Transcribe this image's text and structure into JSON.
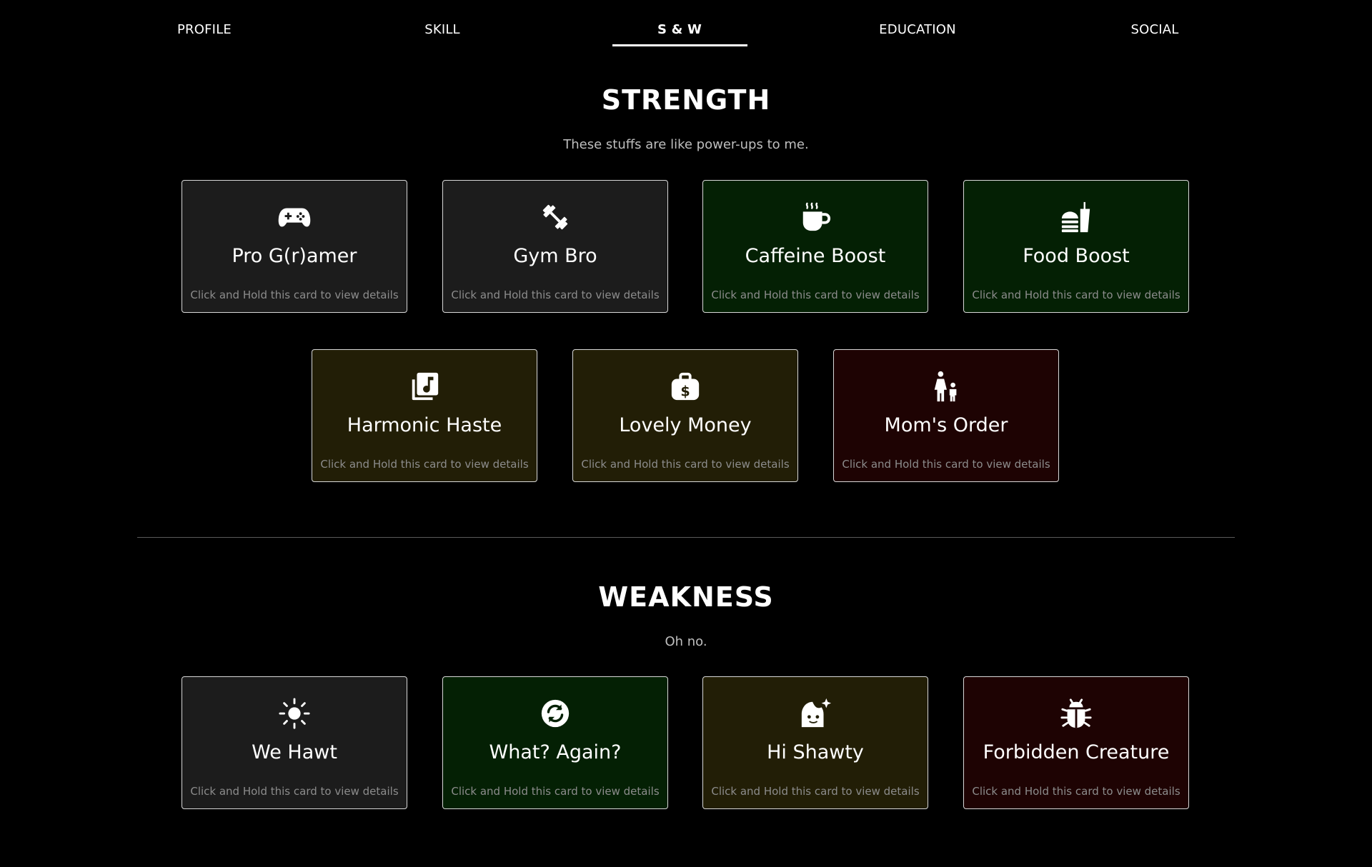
{
  "nav": {
    "items": [
      "PROFILE",
      "SKILL",
      "S & W",
      "EDUCATION",
      "SOCIAL"
    ],
    "active": "S & W"
  },
  "strength": {
    "title": "STRENGTH",
    "subtitle": "These stuffs are like power-ups to me.",
    "cards": [
      {
        "title": "Pro G(r)amer",
        "icon": "gamepad-icon",
        "theme": "gray"
      },
      {
        "title": "Gym Bro",
        "icon": "dumbbell-icon",
        "theme": "gray"
      },
      {
        "title": "Caffeine Boost",
        "icon": "mug-hot-icon",
        "theme": "green"
      },
      {
        "title": "Food Boost",
        "icon": "burger-drink-icon",
        "theme": "green"
      },
      {
        "title": "Harmonic Haste",
        "icon": "music-album-icon",
        "theme": "olive"
      },
      {
        "title": "Lovely Money",
        "icon": "money-bag-icon",
        "theme": "olive"
      },
      {
        "title": "Mom's Order",
        "icon": "parent-child-icon",
        "theme": "maroon"
      }
    ]
  },
  "weakness": {
    "title": "WEAKNESS",
    "subtitle": "Oh no.",
    "cards": [
      {
        "title": "We Hawt",
        "icon": "sun-icon",
        "theme": "gray"
      },
      {
        "title": "What? Again?",
        "icon": "refresh-icon",
        "theme": "green"
      },
      {
        "title": "Hi Shawty",
        "icon": "face-sparkle-icon",
        "theme": "olive"
      },
      {
        "title": "Forbidden Creature",
        "icon": "bug-icon",
        "theme": "maroon"
      }
    ]
  },
  "card_hint": "Click and Hold this card to view details",
  "colors": {
    "background": "#000000",
    "card_gray": "#1c1c1c",
    "card_green": "#042004",
    "card_olive": "#221e06",
    "card_maroon": "#1e0303",
    "card_border": "#d9d9d9",
    "hint_text": "#8c8c8c"
  }
}
